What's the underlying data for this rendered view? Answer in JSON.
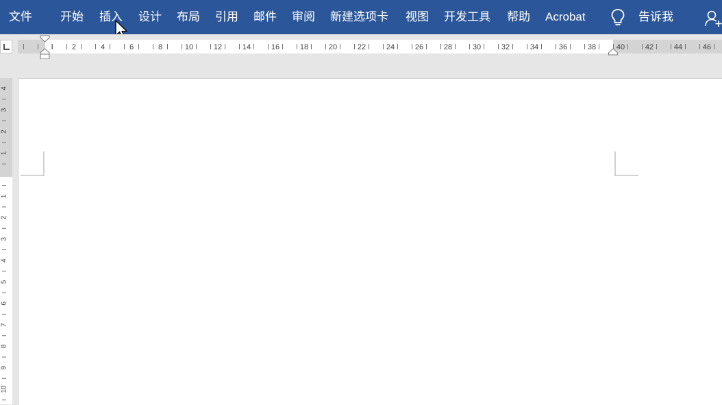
{
  "ribbon": {
    "tabs": [
      {
        "label": "文件",
        "name": "tab-file"
      },
      {
        "label": "开始",
        "name": "tab-home"
      },
      {
        "label": "插入",
        "name": "tab-insert"
      },
      {
        "label": "设计",
        "name": "tab-design"
      },
      {
        "label": "布局",
        "name": "tab-layout"
      },
      {
        "label": "引用",
        "name": "tab-references"
      },
      {
        "label": "邮件",
        "name": "tab-mailings"
      },
      {
        "label": "审阅",
        "name": "tab-review"
      },
      {
        "label": "新建选项卡",
        "name": "tab-new-tab"
      },
      {
        "label": "视图",
        "name": "tab-view"
      },
      {
        "label": "开发工具",
        "name": "tab-developer"
      },
      {
        "label": "帮助",
        "name": "tab-help"
      },
      {
        "label": "Acrobat",
        "name": "tab-acrobat"
      }
    ],
    "tell_me_label": "告诉我",
    "tell_me_icon": "lightbulb-icon",
    "share_icon": "user-add-icon",
    "background_color": "#2b579a"
  },
  "horizontal_ruler": {
    "labels": [
      "2",
      "4",
      "6",
      "8",
      "10",
      "12",
      "14",
      "16",
      "18",
      "20",
      "22",
      "24",
      "26",
      "28",
      "30",
      "32",
      "34",
      "36",
      "38",
      "40",
      "42",
      "44",
      "46"
    ]
  },
  "vertical_ruler": {
    "top_labels": [
      "4",
      "3",
      "2",
      "1"
    ],
    "body_labels": [
      "1",
      "2",
      "3",
      "4",
      "5",
      "6",
      "7",
      "8",
      "9",
      "10"
    ]
  }
}
